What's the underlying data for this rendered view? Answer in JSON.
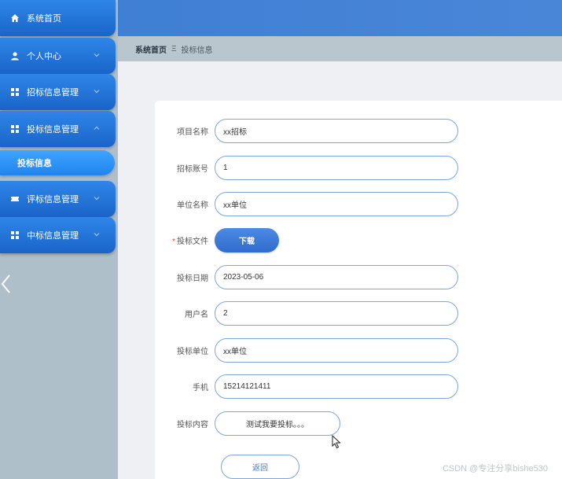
{
  "sidebar": {
    "items": [
      {
        "label": "系统首页",
        "icon": "home-icon"
      },
      {
        "label": "个人中心",
        "icon": "user-icon"
      },
      {
        "label": "招标信息管理",
        "icon": "grid-icon"
      },
      {
        "label": "投标信息管理",
        "icon": "grid-icon"
      },
      {
        "label": "评标信息管理",
        "icon": "ticket-icon"
      },
      {
        "label": "中标信息管理",
        "icon": "grid-icon"
      }
    ],
    "active_sub_item": "投标信息"
  },
  "breadcrumb": {
    "home": "系统首页",
    "separator": "Ξ",
    "current": "投标信息"
  },
  "form": {
    "project_name": {
      "label": "项目名称",
      "value": "xx招标"
    },
    "tender_account": {
      "label": "招标账号",
      "value": "1"
    },
    "unit_name": {
      "label": "单位名称",
      "value": "xx单位"
    },
    "bid_file": {
      "label": "投标文件",
      "required_mark": "*",
      "button": "下载"
    },
    "bid_date": {
      "label": "投标日期",
      "value": "2023-05-06"
    },
    "username": {
      "label": "用户名",
      "value": "2"
    },
    "bid_unit": {
      "label": "投标单位",
      "value": "xx单位"
    },
    "phone": {
      "label": "手机",
      "value": "15214121411"
    },
    "bid_content": {
      "label": "投标内容",
      "value": "测试我要投标。。。"
    },
    "return_button": "返回"
  },
  "watermark": "CSDN @专注分享bishe530",
  "colors": {
    "sidebar_bg": "#aebfca",
    "nav_blue": "#1a64c9",
    "active_blue": "#2f8ff5",
    "header_blue": "#4a86d8",
    "field_border": "#7fa4d9"
  }
}
